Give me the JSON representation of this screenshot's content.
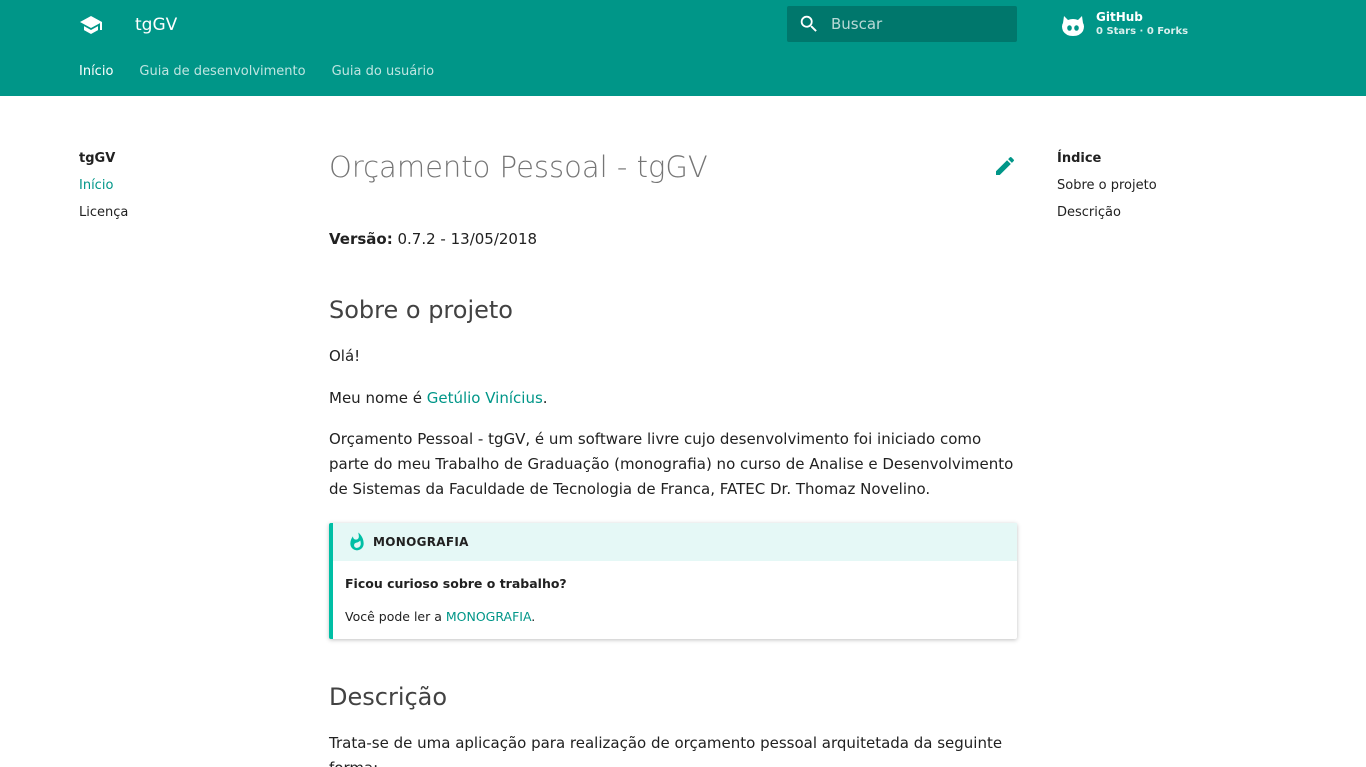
{
  "header": {
    "site_title": "tgGV",
    "search_placeholder": "Buscar",
    "repo": {
      "name": "GitHub",
      "facts": "0 Stars · 0 Forks"
    },
    "tabs": [
      {
        "label": "Início",
        "active": true
      },
      {
        "label": "Guia de desenvolvimento",
        "active": false
      },
      {
        "label": "Guia do usuário",
        "active": false
      }
    ]
  },
  "nav": {
    "title": "tgGV",
    "items": [
      {
        "label": "Início",
        "active": true
      },
      {
        "label": "Licença",
        "active": false
      }
    ]
  },
  "toc": {
    "title": "Índice",
    "items": [
      "Sobre o projeto",
      "Descrição"
    ]
  },
  "content": {
    "title": "Orçamento Pessoal - tgGV",
    "version_label": "Versão:",
    "version_value": " 0.7.2 - 13/05/2018",
    "section1_title": "Sobre o projeto",
    "greeting": "Olá!",
    "name_prefix": "Meu nome é ",
    "name_link": "Getúlio Vinícius",
    "name_suffix": ".",
    "intro": "Orçamento Pessoal - tgGV, é um software livre cujo desenvolvimento foi iniciado como parte do meu Trabalho de Graduação (monografia) no curso de Analise e Desenvolvimento de Sistemas da Faculdade de Tecnologia de Franca, FATEC Dr. Thomaz Novelino.",
    "admonition": {
      "title": "MONOGRAFIA",
      "question": "Ficou curioso sobre o trabalho?",
      "text_prefix": "Você pode ler a ",
      "link": "MONOGRAFIA",
      "text_suffix": "."
    },
    "section2_title": "Descrição",
    "description": "Trata-se de uma aplicação para realização de orçamento pessoal arquitetada da seguinte forma:"
  },
  "colors": {
    "primary": "#009688",
    "accent": "#00bfa5",
    "admonition_bg": "#e5f8f6"
  },
  "icons": {
    "logo": "graduation-cap-icon",
    "search": "search-icon",
    "repo": "github-icon",
    "edit": "pencil-icon",
    "admonition": "flame-icon"
  }
}
